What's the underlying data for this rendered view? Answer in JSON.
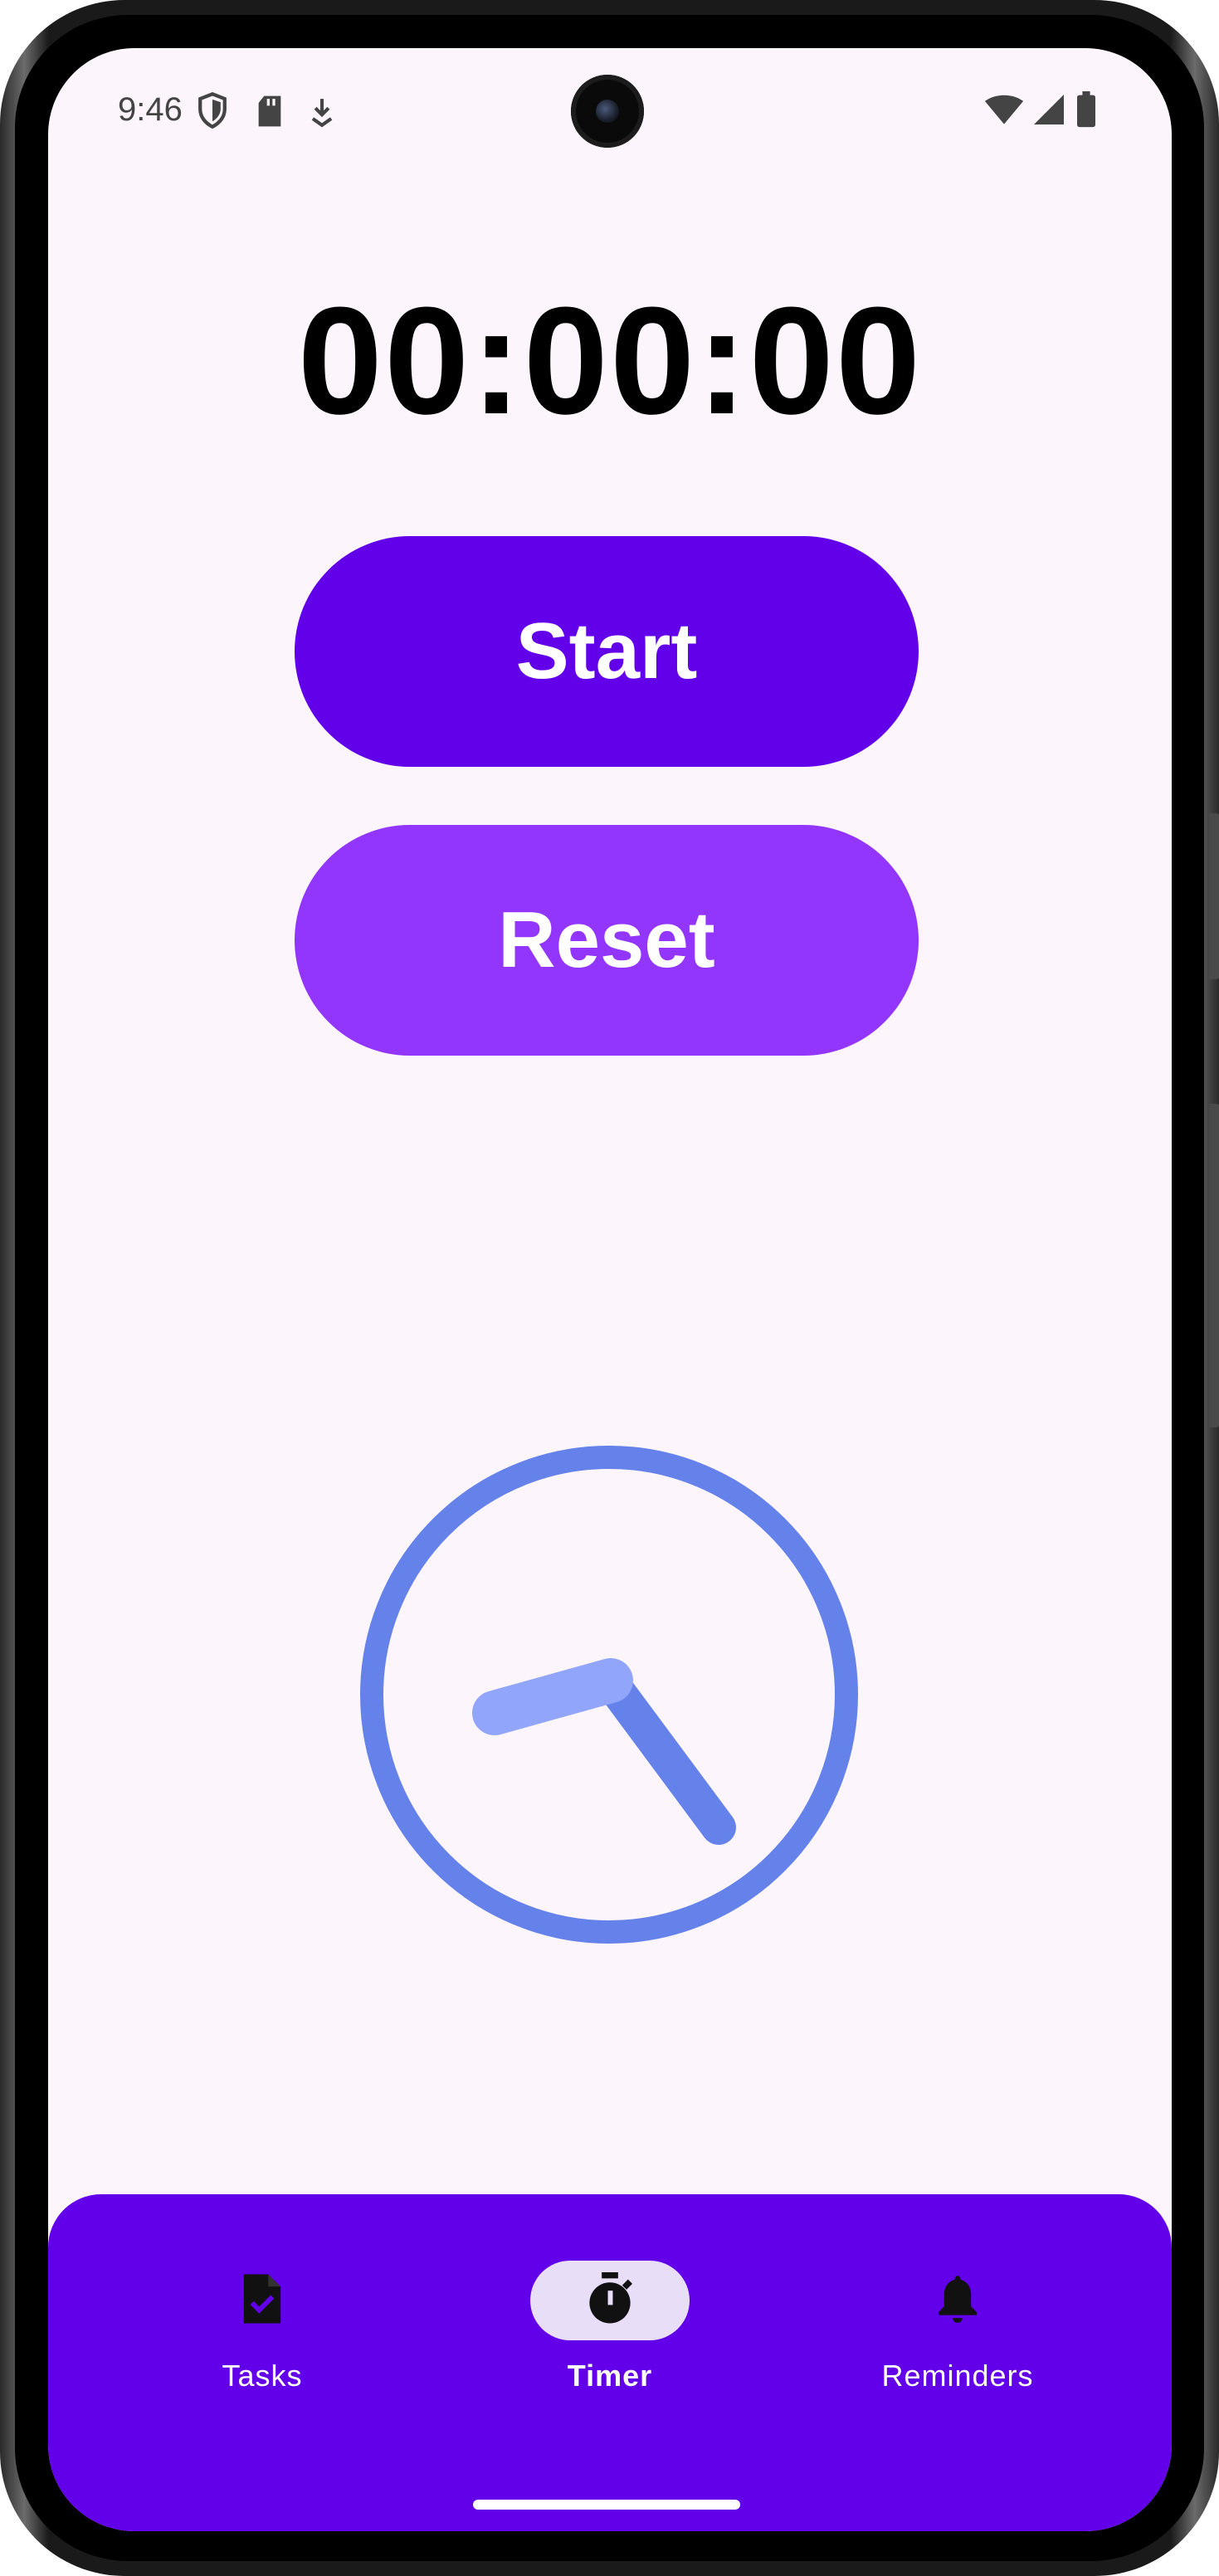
{
  "status_bar": {
    "time": "9:46",
    "left_icons": [
      "shield-icon",
      "sd-card-icon",
      "download-icon"
    ],
    "right_icons": [
      "wifi-icon",
      "cell-signal-icon",
      "battery-icon"
    ]
  },
  "timer": {
    "display": "00:00:00"
  },
  "buttons": {
    "start_label": "Start",
    "reset_label": "Reset",
    "start_color": "#6200ea",
    "reset_color": "#9336fd"
  },
  "clock_illustration": {
    "icon": "clock-icon",
    "ring_color": "#6482ea",
    "hand_color": "#6482ea",
    "short_hand_color": "#91a6fb"
  },
  "bottom_nav": {
    "background": "#6200ea",
    "items": [
      {
        "label": "Tasks",
        "icon": "task-file-icon",
        "active": false
      },
      {
        "label": "Timer",
        "icon": "stopwatch-icon",
        "active": true
      },
      {
        "label": "Reminders",
        "icon": "bell-icon",
        "active": false
      }
    ]
  }
}
